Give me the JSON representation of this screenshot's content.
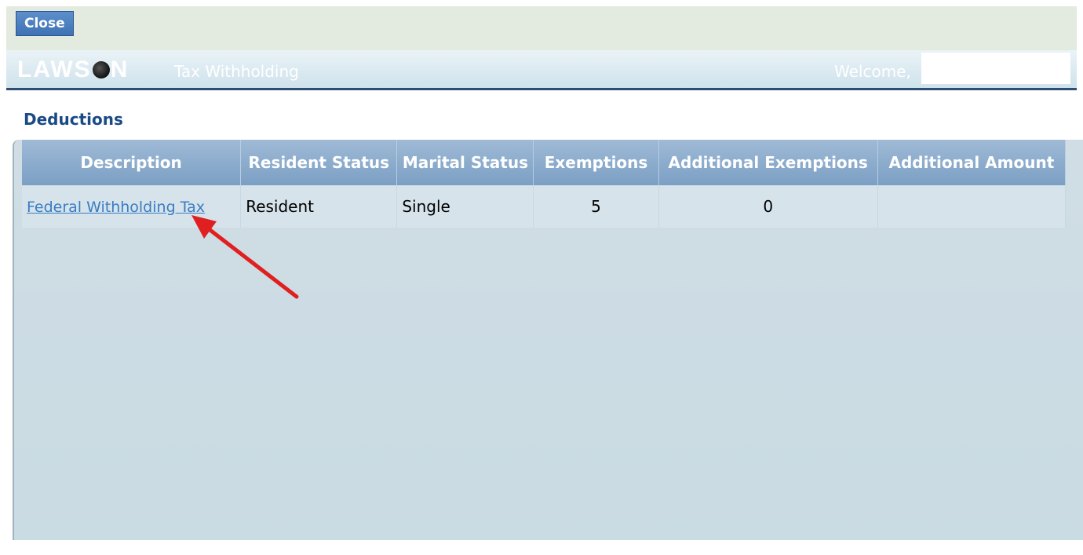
{
  "toolbar": {
    "close_label": "Close"
  },
  "banner": {
    "logo_left": "LAWS",
    "logo_right": "N",
    "title": "Tax Withholding",
    "welcome": "Welcome,"
  },
  "section": {
    "title": "Deductions"
  },
  "table": {
    "headers": {
      "description": "Description",
      "resident": "Resident Status",
      "marital": "Marital Status",
      "exemptions": "Exemptions",
      "additional_exemptions": "Additional Exemptions",
      "additional_amount": "Additional Amount"
    },
    "rows": [
      {
        "description": "Federal Withholding Tax",
        "resident": "Resident",
        "marital": "Single",
        "exemptions": "5",
        "additional_exemptions": "0",
        "additional_amount": ""
      }
    ]
  },
  "colors": {
    "accent": "#3f72b3",
    "header_blue": "#7b9fc4",
    "annotation_arrow": "#e02020"
  },
  "icons": {
    "annotation": "red-arrow-icon"
  }
}
